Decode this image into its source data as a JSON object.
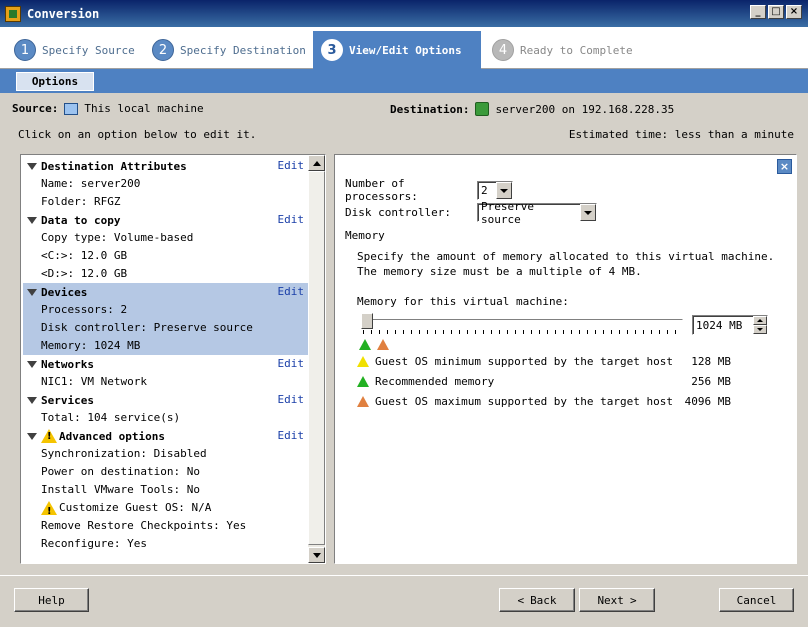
{
  "window": {
    "title": "Conversion",
    "controls": [
      "_",
      "□",
      "×"
    ]
  },
  "steps": [
    {
      "num": "1",
      "label": "Specify Source",
      "state": "done"
    },
    {
      "num": "2",
      "label": "Specify Destination",
      "state": "done"
    },
    {
      "num": "3",
      "label": "View/Edit Options",
      "state": "active"
    },
    {
      "num": "4",
      "label": "Ready to Complete",
      "state": "pending"
    }
  ],
  "subtab": {
    "label": "Options"
  },
  "source": {
    "label": "Source:",
    "value": "This local machine"
  },
  "destination": {
    "label": "Destination:",
    "value": "server200 on 192.168.228.35"
  },
  "hint": "Click on an option below to edit it.",
  "estimated": "Estimated time: less than a minute",
  "edit_label": "Edit",
  "groups": [
    {
      "title": "Destination Attributes",
      "items": [
        "Name: server200",
        "Folder: RFGZ"
      ]
    },
    {
      "title": "Data to copy",
      "items": [
        "Copy type: Volume-based",
        "<C:>: 12.0 GB",
        "<D:>: 12.0 GB"
      ]
    },
    {
      "title": "Devices",
      "items": [
        "Processors: 2",
        "Disk controller: Preserve source",
        "Memory: 1024 MB"
      ]
    },
    {
      "title": "Networks",
      "items": [
        "NIC1: VM Network"
      ]
    },
    {
      "title": "Services",
      "items": [
        "Total: 104 service(s)"
      ]
    },
    {
      "title": "Advanced options",
      "items": [
        "Synchronization: Disabled",
        "Power on destination: No",
        "Install VMware Tools: No",
        "Customize Guest OS: N/A",
        "Remove Restore Checkpoints: Yes",
        "Reconfigure: Yes"
      ]
    }
  ],
  "right": {
    "processors_label": "Number of processors:",
    "processors_value": "2",
    "disk_label": "Disk controller:",
    "disk_value": "Preserve source",
    "memory_group": "Memory",
    "memory_desc": "Specify the amount of memory allocated to this virtual machine. The memory size must be a multiple of 4 MB.",
    "memory_for_label": "Memory for this virtual machine:",
    "memory_value": "1024 MB",
    "legend": [
      {
        "label": "Guest OS minimum supported by the target host",
        "value": "128 MB",
        "color": "#f0e000"
      },
      {
        "label": "Recommended memory",
        "value": "256 MB",
        "color": "#22b022"
      },
      {
        "label": "Guest OS maximum supported by the target host",
        "value": "4096 MB",
        "color": "#e08040"
      }
    ]
  },
  "buttons": {
    "help": "Help",
    "back": "Back",
    "next": "Next",
    "cancel": "Cancel"
  },
  "colors": {
    "accent": "#4e81c2",
    "selected": "#b5c8e4"
  }
}
